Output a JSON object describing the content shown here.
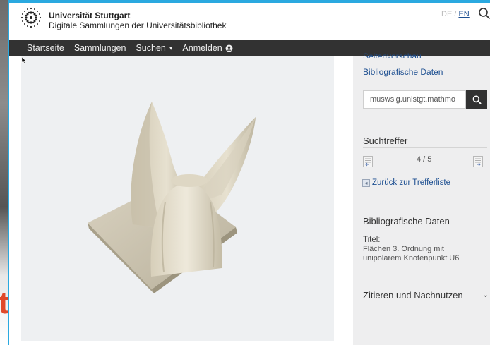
{
  "header": {
    "institution": "Universität Stuttgart",
    "subtitle": "Digitale Sammlungen der Universitätsbibliothek",
    "lang_de": "DE",
    "lang_sep": " / ",
    "lang_en": "EN"
  },
  "nav": {
    "items": [
      "Startseite",
      "Sammlungen",
      "Suchen",
      "Anmelden"
    ]
  },
  "sidebar": {
    "cut_link": "Seitenvorschau",
    "biblio_link": "Bibliografische Daten",
    "search_value": "muswslg.unistgt.mathmo",
    "hits_title": "Suchtreffer",
    "hit_count": "4 / 5",
    "back_link": "Zurück zur Trefferliste",
    "biblio_title": "Bibliografische Daten",
    "title_label": "Titel:",
    "title_value": "Flächen 3. Ordnung mit unipolarem Knotenpunkt U6",
    "cite_title": "Zitieren und Nachnutzen"
  },
  "background": {
    "fragment": "t"
  },
  "colors": {
    "navbar": "#323232",
    "link": "#1d4f91",
    "sidebar_bg": "#eeeeef",
    "viewer_bg": "#eef0f2"
  }
}
